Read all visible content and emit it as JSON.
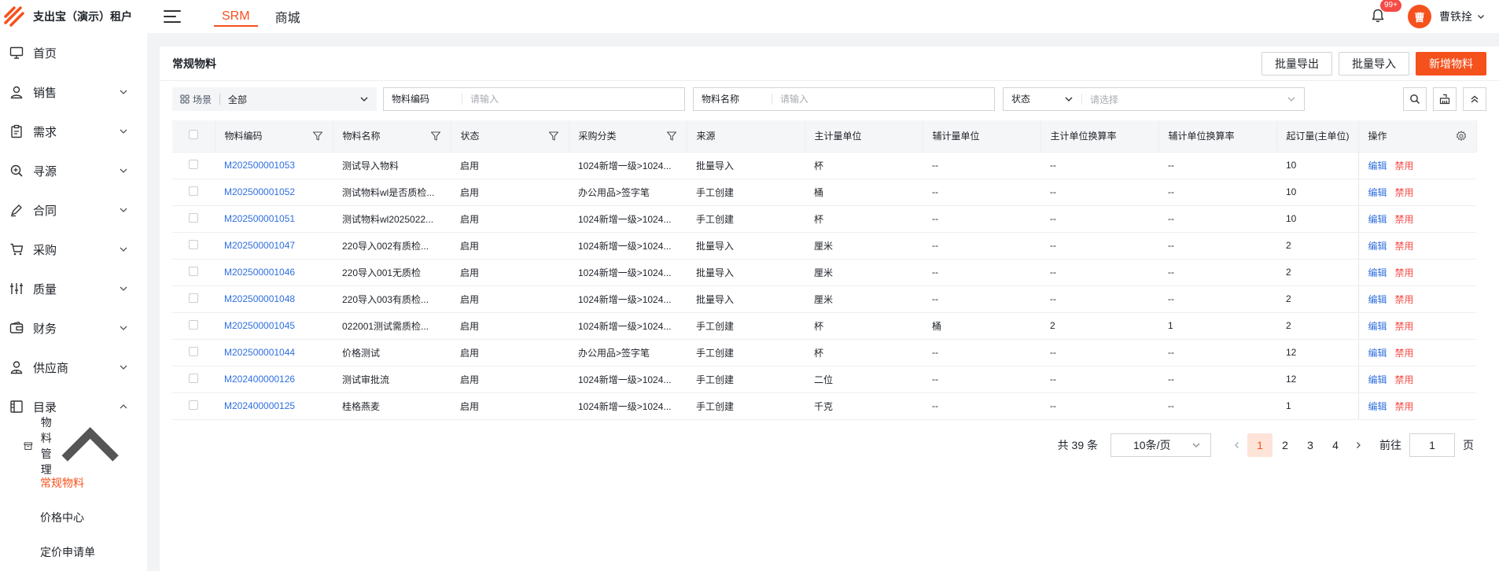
{
  "app": {
    "name": "支出宝（演示）租户"
  },
  "top_nav": {
    "tabs": [
      "SRM",
      "商城"
    ],
    "active": 0
  },
  "user": {
    "badge": "99+",
    "avatar_char": "曹",
    "name": "曹铁拴"
  },
  "sidebar": {
    "items": [
      {
        "label": "首页",
        "icon": "monitor-icon",
        "has_chevron": false
      },
      {
        "label": "销售",
        "icon": "user-icon",
        "has_chevron": true
      },
      {
        "label": "需求",
        "icon": "clipboard-icon",
        "has_chevron": true
      },
      {
        "label": "寻源",
        "icon": "search-zoom-icon",
        "has_chevron": true
      },
      {
        "label": "合同",
        "icon": "pen-icon",
        "has_chevron": true
      },
      {
        "label": "采购",
        "icon": "cart-icon",
        "has_chevron": true
      },
      {
        "label": "质量",
        "icon": "sliders-icon",
        "has_chevron": true
      },
      {
        "label": "财务",
        "icon": "wallet-icon",
        "has_chevron": true
      },
      {
        "label": "供应商",
        "icon": "supplier-icon",
        "has_chevron": true
      },
      {
        "label": "目录",
        "icon": "catalog-icon",
        "has_chevron": true,
        "expanded": true
      }
    ],
    "submenu": {
      "label": "物料管理",
      "icon": "archive-icon"
    },
    "leaves": [
      "常规物料",
      "价格中心",
      "定价申请单"
    ],
    "active_leaf": 0
  },
  "panel": {
    "title": "常规物料",
    "actions": {
      "export": "批量导出",
      "import": "批量导入",
      "add": "新增物料"
    }
  },
  "filters": {
    "scene_label": "场景",
    "scene_value": "全部",
    "code_label": "物料编码",
    "code_placeholder": "请输入",
    "name_label": "物料名称",
    "name_placeholder": "请输入",
    "status_label": "状态",
    "status_placeholder": "请选择"
  },
  "table": {
    "columns": [
      "物料编码",
      "物料名称",
      "状态",
      "采购分类",
      "来源",
      "主计量单位",
      "辅计量单位",
      "主计单位换算率",
      "辅计单位换算率",
      "起订量(主单位)",
      "操作"
    ],
    "edit_label": "编辑",
    "disable_label": "禁用",
    "rows": [
      [
        "M202500001053",
        "测试导入物料",
        "启用",
        "1024新增一级>1024...",
        "批量导入",
        "杯",
        "--",
        "--",
        "--",
        "10"
      ],
      [
        "M202500001052",
        "测试物料wl是否质检...",
        "启用",
        "办公用品>签字笔",
        "手工创建",
        "桶",
        "--",
        "--",
        "--",
        "10"
      ],
      [
        "M202500001051",
        "测试物料wl2025022...",
        "启用",
        "1024新增一级>1024...",
        "手工创建",
        "杯",
        "--",
        "--",
        "--",
        "10"
      ],
      [
        "M202500001047",
        "220导入002有质检...",
        "启用",
        "1024新增一级>1024...",
        "批量导入",
        "厘米",
        "--",
        "--",
        "--",
        "2"
      ],
      [
        "M202500001046",
        "220导入001无质检",
        "启用",
        "1024新增一级>1024...",
        "批量导入",
        "厘米",
        "--",
        "--",
        "--",
        "2"
      ],
      [
        "M202500001048",
        "220导入003有质检...",
        "启用",
        "1024新增一级>1024...",
        "批量导入",
        "厘米",
        "--",
        "--",
        "--",
        "2"
      ],
      [
        "M202500001045",
        "022001测试需质检...",
        "启用",
        "1024新增一级>1024...",
        "手工创建",
        "杯",
        "桶",
        "2",
        "1",
        "2"
      ],
      [
        "M202500001044",
        "价格测试",
        "启用",
        "办公用品>签字笔",
        "手工创建",
        "杯",
        "--",
        "--",
        "--",
        "12"
      ],
      [
        "M202400000126",
        "测试审批流",
        "启用",
        "1024新增一级>1024...",
        "手工创建",
        "二位",
        "--",
        "--",
        "--",
        "12"
      ],
      [
        "M202400000125",
        "桂格燕麦",
        "启用",
        "1024新增一级>1024...",
        "手工创建",
        "千克",
        "--",
        "--",
        "--",
        "1"
      ]
    ]
  },
  "pagination": {
    "total": "共 39 条",
    "page_size": "10条/页",
    "pages": [
      "1",
      "2",
      "3",
      "4"
    ],
    "active_page": 0,
    "goto_label": "前往",
    "goto_value": "1",
    "goto_suffix": "页"
  },
  "colors": {
    "accent": "#f5511d",
    "link": "#2f6fdf",
    "danger": "#f54a45"
  }
}
